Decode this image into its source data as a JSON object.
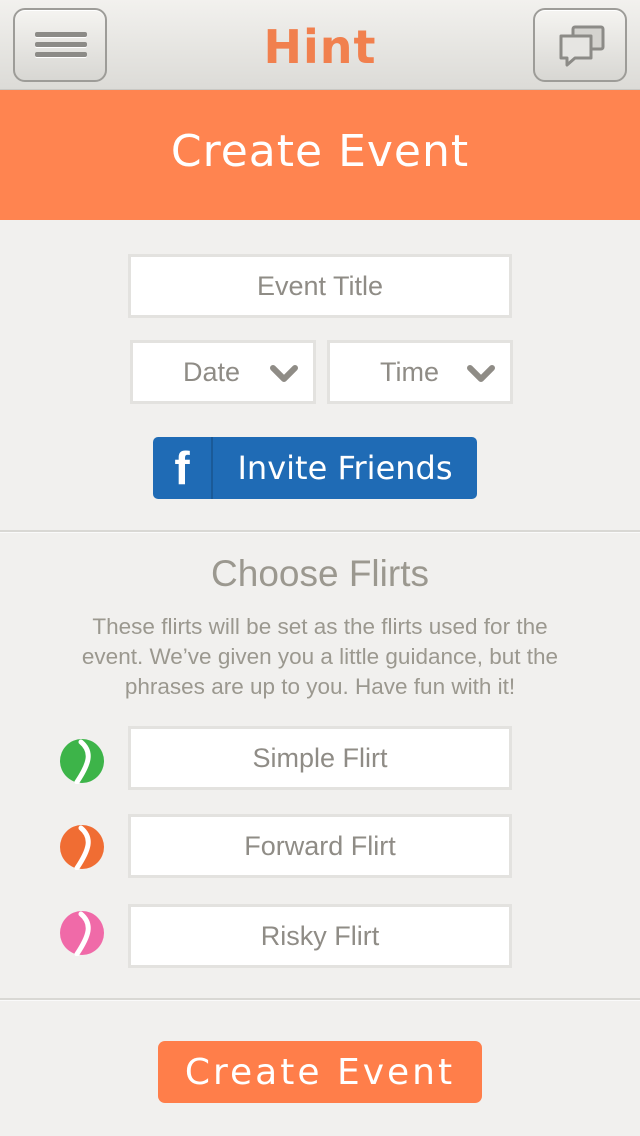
{
  "header": {
    "logo_text": "Hint"
  },
  "banner": {
    "title": "Create Event"
  },
  "form": {
    "event_title_placeholder": "Event Title",
    "date_label": "Date",
    "time_label": "Time",
    "facebook_letter": "f",
    "invite_label": "Invite Friends"
  },
  "flirts": {
    "title": "Choose Flirts",
    "description": "These flirts will be set as the flirts used for the event. We’ve given you a little guidance, but the phrases are up to you. Have fun with it!",
    "items": [
      {
        "label": "Simple Flirt",
        "color": "#3db449",
        "icon": "green-leaf-icon"
      },
      {
        "label": "Forward Flirt",
        "color": "#f06d33",
        "icon": "orange-leaf-icon"
      },
      {
        "label": "Risky Flirt",
        "color": "#f06aa8",
        "icon": "pink-leaf-icon"
      }
    ]
  },
  "footer": {
    "create_label": "Create Event"
  },
  "colors": {
    "brand_orange": "#ff8450",
    "facebook_blue": "#1f6bb5",
    "text_gray": "#8f8c86"
  }
}
